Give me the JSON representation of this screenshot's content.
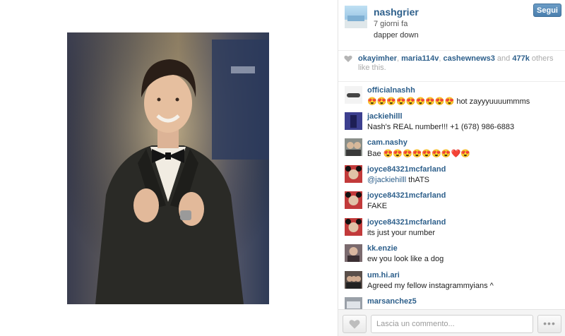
{
  "post": {
    "username": "nashgrier",
    "time": "7 giorni fa",
    "caption": "dapper down",
    "follow_label": "Segui"
  },
  "likes": {
    "users": [
      "okayimher",
      "maria114v",
      "cashewnews3"
    ],
    "sep1": ", ",
    "sep2": ", ",
    "and_text": " and ",
    "count": "477k",
    "others_text": " others like this."
  },
  "comments": [
    {
      "user": "officialnashh",
      "text": "😍😍😍😍😍😍😍😍😍 hot zayyyuuuummms"
    },
    {
      "user": "jackiehilll",
      "text": "Nash's REAL number!!! +1 (678) 986-6883"
    },
    {
      "user": "cam.nashy",
      "text": "Bae 😍😍😍😍😍😍😍❤️😍"
    },
    {
      "user": "joyce84321mcfarland",
      "mention": "@jackiehilll",
      "text": " thATS"
    },
    {
      "user": "joyce84321mcfarland",
      "text": "FAKE"
    },
    {
      "user": "joyce84321mcfarland",
      "text": "its just your number"
    },
    {
      "user": "kk.enzie",
      "text": "ew you look like a dog"
    },
    {
      "user": "um.hi.ari",
      "text": "Agreed my fellow instagrammyians ^"
    },
    {
      "user": "marsanchez5",
      "text": ""
    }
  ],
  "comment_bar": {
    "placeholder": "Lascia un commento...",
    "more_label": "•••"
  },
  "colors": {
    "link_blue": "#2d5f8b",
    "follow_button": "#4a7fae"
  }
}
